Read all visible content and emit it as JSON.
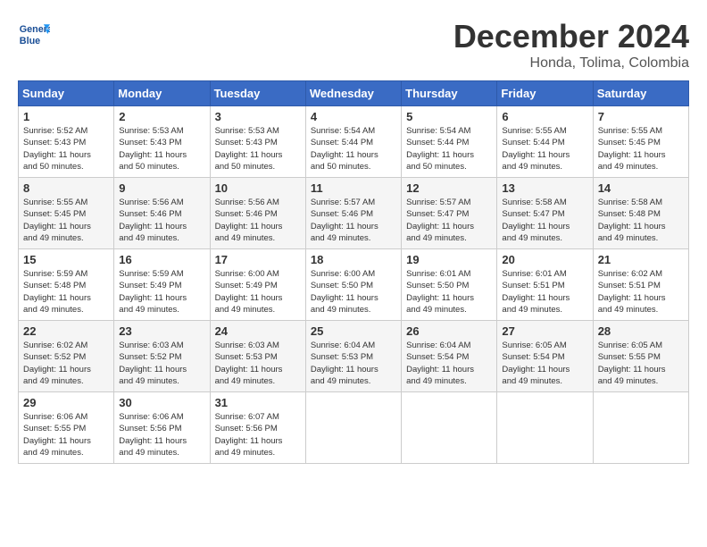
{
  "logo": {
    "line1": "General",
    "line2": "Blue"
  },
  "title": "December 2024",
  "subtitle": "Honda, Tolima, Colombia",
  "days_header": [
    "Sunday",
    "Monday",
    "Tuesday",
    "Wednesday",
    "Thursday",
    "Friday",
    "Saturday"
  ],
  "weeks": [
    [
      {
        "day": "1",
        "sunrise": "5:52 AM",
        "sunset": "5:43 PM",
        "daylight_hours": "11",
        "daylight_mins": "50"
      },
      {
        "day": "2",
        "sunrise": "5:53 AM",
        "sunset": "5:43 PM",
        "daylight_hours": "11",
        "daylight_mins": "50"
      },
      {
        "day": "3",
        "sunrise": "5:53 AM",
        "sunset": "5:43 PM",
        "daylight_hours": "11",
        "daylight_mins": "50"
      },
      {
        "day": "4",
        "sunrise": "5:54 AM",
        "sunset": "5:44 PM",
        "daylight_hours": "11",
        "daylight_mins": "50"
      },
      {
        "day": "5",
        "sunrise": "5:54 AM",
        "sunset": "5:44 PM",
        "daylight_hours": "11",
        "daylight_mins": "50"
      },
      {
        "day": "6",
        "sunrise": "5:55 AM",
        "sunset": "5:44 PM",
        "daylight_hours": "11",
        "daylight_mins": "49"
      },
      {
        "day": "7",
        "sunrise": "5:55 AM",
        "sunset": "5:45 PM",
        "daylight_hours": "11",
        "daylight_mins": "49"
      }
    ],
    [
      {
        "day": "8",
        "sunrise": "5:55 AM",
        "sunset": "5:45 PM",
        "daylight_hours": "11",
        "daylight_mins": "49"
      },
      {
        "day": "9",
        "sunrise": "5:56 AM",
        "sunset": "5:46 PM",
        "daylight_hours": "11",
        "daylight_mins": "49"
      },
      {
        "day": "10",
        "sunrise": "5:56 AM",
        "sunset": "5:46 PM",
        "daylight_hours": "11",
        "daylight_mins": "49"
      },
      {
        "day": "11",
        "sunrise": "5:57 AM",
        "sunset": "5:46 PM",
        "daylight_hours": "11",
        "daylight_mins": "49"
      },
      {
        "day": "12",
        "sunrise": "5:57 AM",
        "sunset": "5:47 PM",
        "daylight_hours": "11",
        "daylight_mins": "49"
      },
      {
        "day": "13",
        "sunrise": "5:58 AM",
        "sunset": "5:47 PM",
        "daylight_hours": "11",
        "daylight_mins": "49"
      },
      {
        "day": "14",
        "sunrise": "5:58 AM",
        "sunset": "5:48 PM",
        "daylight_hours": "11",
        "daylight_mins": "49"
      }
    ],
    [
      {
        "day": "15",
        "sunrise": "5:59 AM",
        "sunset": "5:48 PM",
        "daylight_hours": "11",
        "daylight_mins": "49"
      },
      {
        "day": "16",
        "sunrise": "5:59 AM",
        "sunset": "5:49 PM",
        "daylight_hours": "11",
        "daylight_mins": "49"
      },
      {
        "day": "17",
        "sunrise": "6:00 AM",
        "sunset": "5:49 PM",
        "daylight_hours": "11",
        "daylight_mins": "49"
      },
      {
        "day": "18",
        "sunrise": "6:00 AM",
        "sunset": "5:50 PM",
        "daylight_hours": "11",
        "daylight_mins": "49"
      },
      {
        "day": "19",
        "sunrise": "6:01 AM",
        "sunset": "5:50 PM",
        "daylight_hours": "11",
        "daylight_mins": "49"
      },
      {
        "day": "20",
        "sunrise": "6:01 AM",
        "sunset": "5:51 PM",
        "daylight_hours": "11",
        "daylight_mins": "49"
      },
      {
        "day": "21",
        "sunrise": "6:02 AM",
        "sunset": "5:51 PM",
        "daylight_hours": "11",
        "daylight_mins": "49"
      }
    ],
    [
      {
        "day": "22",
        "sunrise": "6:02 AM",
        "sunset": "5:52 PM",
        "daylight_hours": "11",
        "daylight_mins": "49"
      },
      {
        "day": "23",
        "sunrise": "6:03 AM",
        "sunset": "5:52 PM",
        "daylight_hours": "11",
        "daylight_mins": "49"
      },
      {
        "day": "24",
        "sunrise": "6:03 AM",
        "sunset": "5:53 PM",
        "daylight_hours": "11",
        "daylight_mins": "49"
      },
      {
        "day": "25",
        "sunrise": "6:04 AM",
        "sunset": "5:53 PM",
        "daylight_hours": "11",
        "daylight_mins": "49"
      },
      {
        "day": "26",
        "sunrise": "6:04 AM",
        "sunset": "5:54 PM",
        "daylight_hours": "11",
        "daylight_mins": "49"
      },
      {
        "day": "27",
        "sunrise": "6:05 AM",
        "sunset": "5:54 PM",
        "daylight_hours": "11",
        "daylight_mins": "49"
      },
      {
        "day": "28",
        "sunrise": "6:05 AM",
        "sunset": "5:55 PM",
        "daylight_hours": "11",
        "daylight_mins": "49"
      }
    ],
    [
      {
        "day": "29",
        "sunrise": "6:06 AM",
        "sunset": "5:55 PM",
        "daylight_hours": "11",
        "daylight_mins": "49"
      },
      {
        "day": "30",
        "sunrise": "6:06 AM",
        "sunset": "5:56 PM",
        "daylight_hours": "11",
        "daylight_mins": "49"
      },
      {
        "day": "31",
        "sunrise": "6:07 AM",
        "sunset": "5:56 PM",
        "daylight_hours": "11",
        "daylight_mins": "49"
      },
      null,
      null,
      null,
      null
    ]
  ]
}
